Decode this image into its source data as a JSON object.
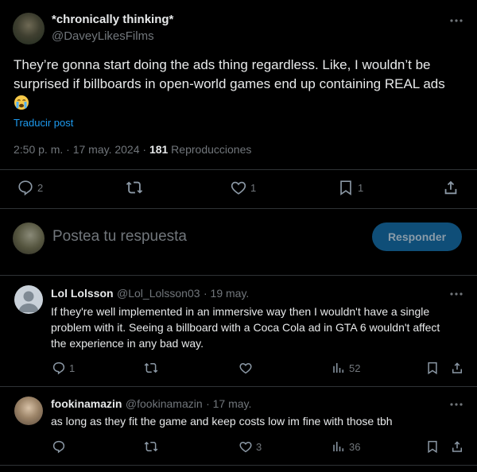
{
  "main_tweet": {
    "display_name": "*chronically thinking*",
    "handle": "@DaveyLikesFilms",
    "text": "They’re gonna start doing the ads thing regardless. Like, I wouldn’t be surprised if billboards in open-world games end up containing REAL ads",
    "emoji": "😭",
    "translate_label": "Traducir post",
    "timestamp": "2:50 p. m. · 17 may. 2024 · ",
    "views_count": "181",
    "views_label": " Reproducciones",
    "stats": {
      "replies": "2",
      "reposts": "",
      "likes": "1",
      "bookmarks": "1"
    }
  },
  "composer": {
    "placeholder": "Postea tu respuesta",
    "button_label": "Responder"
  },
  "replies": [
    {
      "display_name": "Lol Lolsson",
      "handle": "@Lol_Lolsson03",
      "date": "· 19 may.",
      "text": "If they're well implemented in an immersive way then I wouldn't have a single problem with it. Seeing a billboard with a Coca Cola ad in GTA 6 wouldn't affect the experience in any bad way.",
      "stats": {
        "replies": "1",
        "reposts": "",
        "likes": "",
        "views": "52"
      }
    },
    {
      "display_name": "fookinamazin",
      "handle": "@fookinamazin",
      "date": "· 17 may.",
      "text": "as long as they fit the game and keep costs low im fine with those tbh",
      "stats": {
        "replies": "",
        "reposts": "",
        "likes": "3",
        "views": "36"
      }
    }
  ],
  "colors": {
    "background": "#000000",
    "text": "#e7e9ea",
    "muted": "#71767b",
    "accent": "#1d9bf0",
    "divider": "#2f3336"
  }
}
